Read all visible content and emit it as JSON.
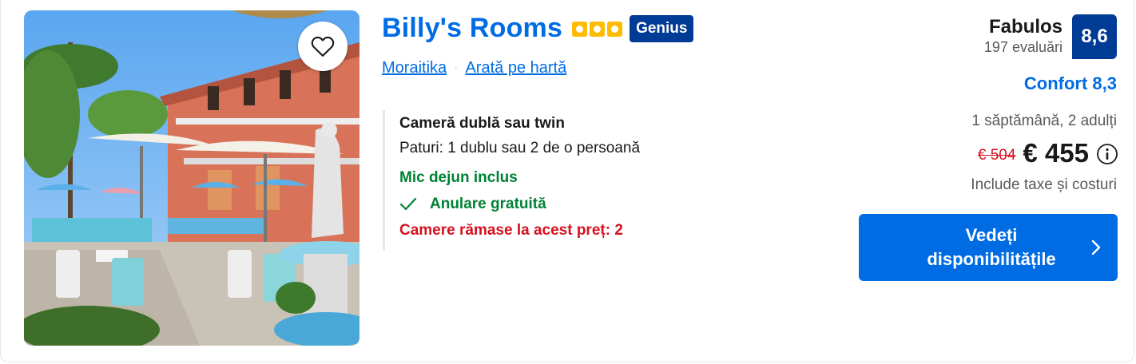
{
  "property": {
    "name": "Billy's Rooms",
    "star_rating": 3,
    "badge": "Genius",
    "location": "Moraitika",
    "map_link": "Arată pe hartă",
    "location_separator": "·"
  },
  "room": {
    "name": "Cameră dublă sau twin",
    "beds": "Paturi: 1 dublu sau 2 de o persoană",
    "breakfast": "Mic dejun inclus",
    "cancellation": "Anulare gratuită",
    "rooms_left": "Camere rămase la acest preț: 2"
  },
  "review": {
    "label": "Fabulos",
    "count": "197 evaluări",
    "score": "8,6",
    "comfort": "Confort 8,3"
  },
  "pricing": {
    "stay": "1 săptămână, 2 adulți",
    "old_price": "€ 504",
    "price": "€ 455",
    "taxes_note": "Include taxe și costuri"
  },
  "cta": {
    "label": "Vedeți\ndisponibilitățile"
  },
  "icons": {
    "favorite": "heart-outline-icon",
    "check": "checkmark-icon",
    "info": "info-circle-icon",
    "chevron": "chevron-right-icon"
  },
  "colors": {
    "link_blue": "#006ce4",
    "dark_blue": "#003b95",
    "green": "#008234",
    "red": "#d4111e",
    "star_yellow": "#febb02"
  }
}
